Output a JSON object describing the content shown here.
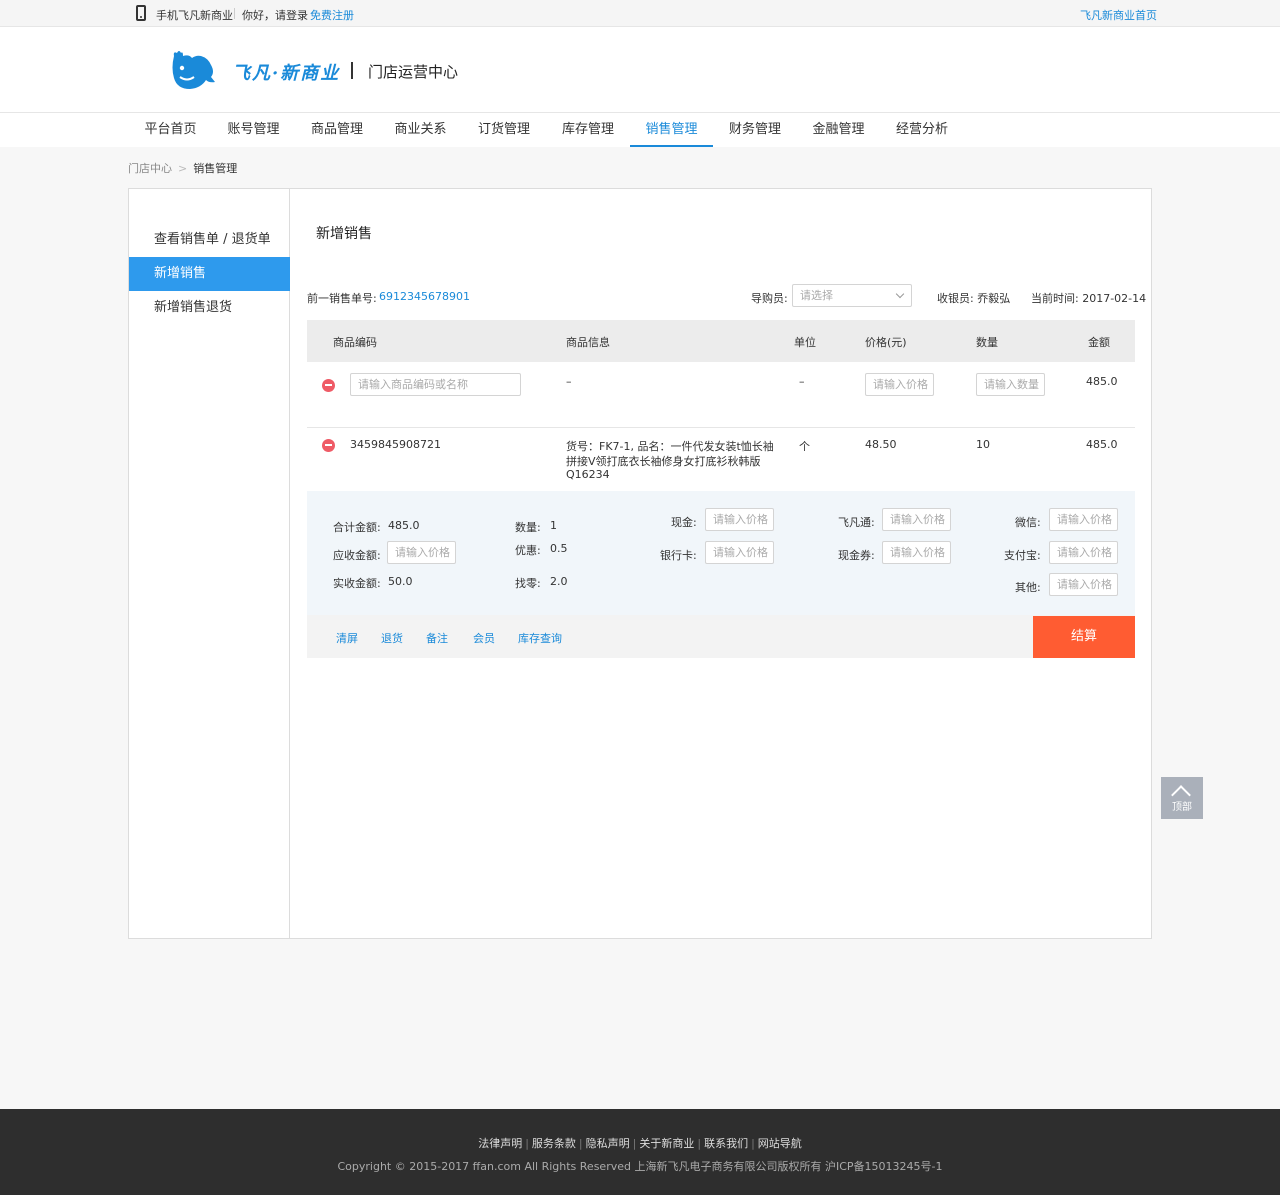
{
  "topbar": {
    "mobile_label": "手机飞凡新商业",
    "greeting": "你好，请登录",
    "register": "免费注册",
    "home_link": "飞凡新商业首页"
  },
  "header": {
    "logo_text": "飞凡·新商业",
    "center_title": "门店运营中心"
  },
  "nav": {
    "items": [
      "平台首页",
      "账号管理",
      "商品管理",
      "商业关系",
      "订货管理",
      "库存管理",
      "销售管理",
      "财务管理",
      "金融管理",
      "经营分析"
    ],
    "active": "销售管理"
  },
  "breadcrumb": {
    "root": "门店中心",
    "sep": ">",
    "current": "销售管理"
  },
  "sidebar": {
    "items": [
      "查看销售单 / 退货单",
      "新增销售",
      "新增销售退货"
    ],
    "active": "新增销售"
  },
  "page": {
    "title": "新增销售",
    "prev_order_label": "前一销售单号:",
    "prev_order_value": "6912345678901",
    "guide_label": "导购员:",
    "guide_placeholder": "请选择",
    "cashier": "收银员: 乔毅弘",
    "current_time": "当前时间: 2017-02-14"
  },
  "table": {
    "headers": [
      "商品编码",
      "商品信息",
      "单位",
      "价格(元)",
      "数量",
      "金额"
    ],
    "input_row": {
      "code_placeholder": "请输入商品编码或名称",
      "info": "–",
      "unit": "–",
      "price_placeholder": "请输入价格",
      "qty_placeholder": "请输入数量",
      "amount": "485.0"
    },
    "rows": [
      {
        "code": "3459845908721",
        "info_lines": [
          "货号：FK7-1, 品名：一件代发女装t恤长袖",
          "拼接V领打底衣长袖修身女打底衫秋韩版",
          "Q16234"
        ],
        "unit": "个",
        "price": "48.50",
        "qty": "10",
        "amount": "485.0"
      }
    ]
  },
  "summary": {
    "total_label": "合计金额:",
    "total_value": "485.0",
    "receivable_label": "应收金额:",
    "receivable_placeholder": "请输入价格",
    "received_label": "实收金额:",
    "received_value": "50.0",
    "qty_label": "数量:",
    "qty_value": "1",
    "discount_label": "优惠:",
    "discount_value": "0.5",
    "change_label": "找零:",
    "change_value": "2.0",
    "pay": {
      "cash": "现金:",
      "bankcard": "银行卡:",
      "feifan": "飞凡通:",
      "voucher": "现金券:",
      "wechat": "微信:",
      "alipay": "支付宝:",
      "other": "其他:",
      "placeholder": "请输入价格"
    }
  },
  "actions": {
    "clear": "清屏",
    "return": "退货",
    "note": "备注",
    "member": "会员",
    "stock": "库存查询",
    "settle": "结算"
  },
  "back_to_top": "顶部",
  "footer": {
    "links": [
      "法律声明",
      "服务条款",
      "隐私声明",
      "关于新商业",
      "联系我们",
      "网站导航"
    ],
    "copyright": "Copyright © 2015-2017 ffan.com All Rights Reserved 上海新飞凡电子商务有限公司版权所有 沪ICP备15013245号-1"
  },
  "colors": {
    "accent": "#1a8ad9",
    "sidebar_active": "#2e9aed",
    "settle": "#ff5c32",
    "remove": "#ef5b66",
    "footer_bg": "#2e2e2e"
  }
}
